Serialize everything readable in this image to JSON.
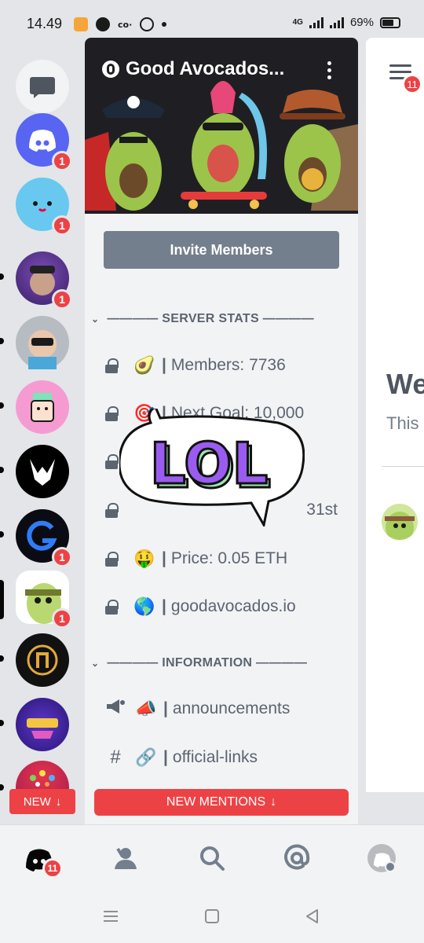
{
  "status_bar": {
    "time": "14.49",
    "network": "4G",
    "battery": "69%"
  },
  "server_rail": {
    "servers": [
      {
        "name": "direct-messages",
        "badge": ""
      },
      {
        "name": "discord",
        "badge": "1"
      },
      {
        "name": "smiley-server",
        "badge": "1"
      },
      {
        "name": "ape-server",
        "badge": "1"
      },
      {
        "name": "vr-server",
        "badge": ""
      },
      {
        "name": "pink-nft-server",
        "badge": ""
      },
      {
        "name": "rhino-server",
        "badge": ""
      },
      {
        "name": "g-server",
        "badge": "1"
      },
      {
        "name": "good-avocados",
        "badge": "1"
      },
      {
        "name": "gold-emblem-server",
        "badge": ""
      },
      {
        "name": "metaverse-server",
        "badge": ""
      },
      {
        "name": "colorful-server",
        "badge": ""
      }
    ],
    "new_button": "NEW"
  },
  "server": {
    "title": "Good Avocados...",
    "invite_label": "Invite Members",
    "categories": [
      {
        "label": "———— SERVER STATS ————"
      },
      {
        "label": "———— INFORMATION ————"
      }
    ],
    "stats_channels": [
      {
        "emoji": "🥑",
        "name": "Members: 7736"
      },
      {
        "emoji": "🎯",
        "name": "Next Goal: 10,000"
      },
      {
        "emoji": "",
        "name": ""
      },
      {
        "emoji": "",
        "name": "31st"
      },
      {
        "emoji": "🤑",
        "name": "Price: 0.05 ETH"
      },
      {
        "emoji": "🌎",
        "name": "goodavocados.io"
      }
    ],
    "info_channels": [
      {
        "emoji": "📣",
        "name": "announcements",
        "icon": "announcement-locked-icon"
      },
      {
        "emoji": "🔗",
        "name": "official-links",
        "icon": "hash-locked-icon"
      }
    ],
    "new_mentions": "NEW MENTIONS"
  },
  "sticker": {
    "text": "LOL"
  },
  "chat_preview": {
    "badge": "11",
    "welcome_fragment": "We",
    "this_fragment": "This"
  },
  "bottom_nav": {
    "home_badge": "11",
    "items": [
      "home-icon",
      "friends-icon",
      "search-icon",
      "mentions-icon",
      "profile-icon"
    ]
  },
  "colors": {
    "accent_red": "#ed4245",
    "discord_blurple": "#5865f2",
    "panel_bg": "#f2f3f5",
    "rail_bg": "#e3e5e8"
  }
}
